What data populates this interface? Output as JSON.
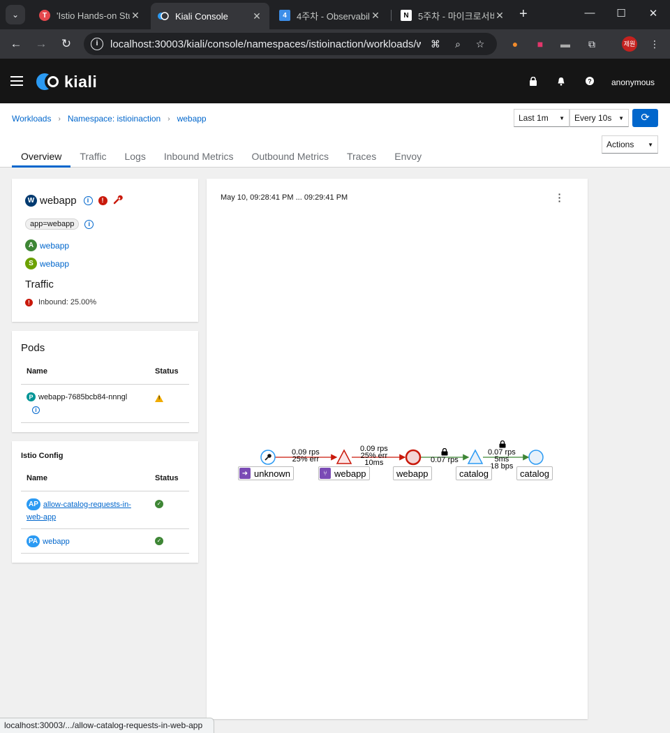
{
  "browser": {
    "tabs": [
      {
        "title": "'Istio Hands-on Stu",
        "fav_color": "#e5484d",
        "fav_glyph": "T"
      },
      {
        "title": "Kiali Console",
        "fav_color": "#2b9af3",
        "fav_glyph": ""
      },
      {
        "title": "4주차 - Observabilit",
        "fav_color": "#3c8ee8",
        "fav_glyph": "4"
      },
      {
        "title": "5주차 - 마이크로서비",
        "fav_color": "#ffffff",
        "fav_glyph": "N"
      }
    ],
    "url": "localhost:30003/kiali/console/namespaces/istioinaction/workloads/w...",
    "profile_label": "제원",
    "status_url": "localhost:30003/.../allow-catalog-requests-in-web-app"
  },
  "header": {
    "logo": "kiali",
    "user": "anonymous"
  },
  "breadcrumb": {
    "workloads": "Workloads",
    "namespace": "Namespace: istioinaction",
    "current": "webapp"
  },
  "controls": {
    "duration": "Last 1m",
    "interval": "Every 10s",
    "actions": "Actions"
  },
  "tabs": [
    "Overview",
    "Traffic",
    "Logs",
    "Inbound Metrics",
    "Outbound Metrics",
    "Traces",
    "Envoy"
  ],
  "overview": {
    "badge": "W",
    "name": "webapp",
    "label": "app=webapp",
    "app_badge": "A",
    "app_link": "webapp",
    "service_badge": "S",
    "service_link": "webapp",
    "traffic_title": "Traffic",
    "inbound": "Inbound: 25.00%"
  },
  "pods": {
    "title": "Pods",
    "col_name": "Name",
    "col_status": "Status",
    "rows": [
      {
        "badge": "P",
        "name": "webapp-7685bcb84-nnngl",
        "status": "warning"
      }
    ]
  },
  "istio_config": {
    "title": "Istio Config",
    "col_name": "Name",
    "col_status": "Status",
    "rows": [
      {
        "badge": "AP",
        "name_line1": "allow-catalog-requests-in-",
        "name_line2": "web-app",
        "status": "ok"
      },
      {
        "badge": "PA",
        "name": "webapp",
        "status": "ok"
      }
    ]
  },
  "graph": {
    "time_range": "May 10, 09:28:41 PM ... 09:29:41 PM",
    "nodes": {
      "unknown": "unknown",
      "webapp_app": "webapp",
      "webapp_workload": "webapp",
      "catalog_svc": "catalog",
      "catalog_workload": "catalog"
    },
    "edges": {
      "e1": [
        "0.09 rps",
        "25% err"
      ],
      "e2": [
        "0.09 rps",
        "25% err",
        "10ms"
      ],
      "e3": [
        "0.07 rps"
      ],
      "e4": [
        "0.07 rps",
        "5ms",
        "18 bps"
      ]
    }
  },
  "colors": {
    "primary": "#0066cc",
    "danger": "#c9190b",
    "success": "#3e8635",
    "warning": "#f0ab00",
    "edge_error": "#c9190b",
    "edge_ok": "#3e8635"
  }
}
